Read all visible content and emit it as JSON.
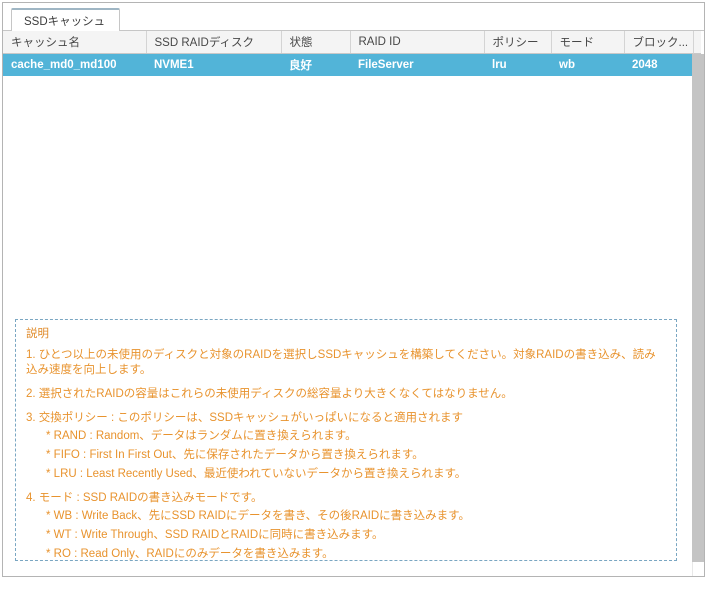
{
  "window": {
    "tab": {
      "label": "SSDキャッシュ"
    }
  },
  "table": {
    "columns": [
      {
        "key": "cache_name",
        "label": "キャッシュ名"
      },
      {
        "key": "ssd_raid",
        "label": "SSD RAIDディスク"
      },
      {
        "key": "status",
        "label": "状態"
      },
      {
        "key": "raid_id",
        "label": "RAID ID"
      },
      {
        "key": "policy",
        "label": "ポリシー"
      },
      {
        "key": "mode",
        "label": "モード"
      },
      {
        "key": "block",
        "label": "ブロック..."
      }
    ],
    "rows": [
      {
        "selected": true,
        "cache_name": "cache_md0_md100",
        "ssd_raid": "NVME1",
        "status": "良好",
        "raid_id": "FileServer",
        "policy": "lru",
        "mode": "wb",
        "block": "2048"
      }
    ],
    "selected_row_color": "#52b4d8",
    "header_bg_color": "#f4f4f4"
  },
  "description": {
    "title": "説明",
    "accent_color": "#e8932e",
    "border_color": "#7aa6c2",
    "items": [
      {
        "text": "1. ひとつ以上の未使用のディスクと対象のRAIDを選択しSSDキャッシュを構築してください。対象RAIDの書き込み、読み込み速度を向上します。",
        "subs": []
      },
      {
        "text": "2. 選択されたRAIDの容量はこれらの未使用ディスクの総容量より大きくなくてはなりません。",
        "subs": []
      },
      {
        "text": "3. 交換ポリシー : このポリシーは、SSDキャッシュがいっぱいになると適用されます",
        "subs": [
          "* RAND : Random、データはランダムに置き換えられます。",
          "* FIFO : First In First Out、先に保存されたデータから置き換えられます。",
          "* LRU : Least Recently Used、最近使われていないデータから置き換えられます。"
        ]
      },
      {
        "text": "4. モード : SSD RAIDの書き込みモードです。",
        "subs": [
          "* WB : Write Back、先にSSD RAIDにデータを書き、その後RAIDに書き込みます。",
          "* WT : Write Through、SSD RAIDとRAIDに同時に書き込みます。",
          "* RO : Read Only、RAIDにのみデータを書き込みます。"
        ]
      }
    ]
  },
  "scrollbar": {
    "orientation": "vertical",
    "thumb_color": "#c4c4c4"
  }
}
